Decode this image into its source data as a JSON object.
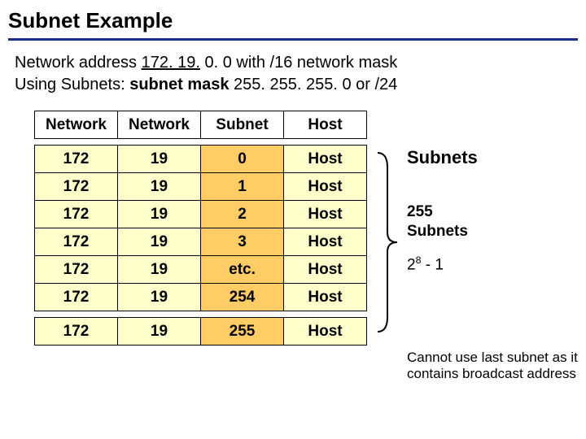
{
  "title": "Subnet Example",
  "intro_line1_a": "Network address ",
  "intro_line1_b_u": "172. 19.",
  "intro_line1_c": " 0. 0 with /16 network mask",
  "intro_line2_a": "Using Subnets: ",
  "intro_line2_b": "subnet mask",
  "intro_line2_c": " 255. 255. 255. 0 or /24",
  "header": {
    "c1": "Network",
    "c2": "Network",
    "c3": "Subnet",
    "c4": "Host"
  },
  "rows": [
    {
      "c1": "172",
      "c2": "19",
      "c3": "0",
      "c4": "Host"
    },
    {
      "c1": "172",
      "c2": "19",
      "c3": "1",
      "c4": "Host"
    },
    {
      "c1": "172",
      "c2": "19",
      "c3": "2",
      "c4": "Host"
    },
    {
      "c1": "172",
      "c2": "19",
      "c3": "3",
      "c4": "Host"
    },
    {
      "c1": "172",
      "c2": "19",
      "c3": "etc.",
      "c4": "Host"
    },
    {
      "c1": "172",
      "c2": "19",
      "c3": "254",
      "c4": "Host"
    }
  ],
  "last_row": {
    "c1": "172",
    "c2": "19",
    "c3": "255",
    "c4": "Host"
  },
  "side": {
    "subnets_label": "Subnets",
    "count_255": "255",
    "count_subnets": "Subnets",
    "pow_a": "2",
    "pow_exp": "8",
    "pow_b": " - 1"
  },
  "footnote": "Cannot use last subnet as it contains broadcast address",
  "chart_data": {
    "type": "table",
    "title": "Subnet Example – /16 network 172.19.0.0 subnetted with /24",
    "columns": [
      "Network",
      "Network",
      "Subnet",
      "Host"
    ],
    "rows": [
      [
        "172",
        "19",
        "0",
        "Host"
      ],
      [
        "172",
        "19",
        "1",
        "Host"
      ],
      [
        "172",
        "19",
        "2",
        "Host"
      ],
      [
        "172",
        "19",
        "3",
        "Host"
      ],
      [
        "172",
        "19",
        "etc.",
        "Host"
      ],
      [
        "172",
        "19",
        "254",
        "Host"
      ],
      [
        "172",
        "19",
        "255",
        "Host"
      ]
    ],
    "annotations": {
      "subnet_count": 255,
      "formula": "2^8 - 1",
      "note": "Cannot use last subnet as it contains broadcast address"
    }
  }
}
